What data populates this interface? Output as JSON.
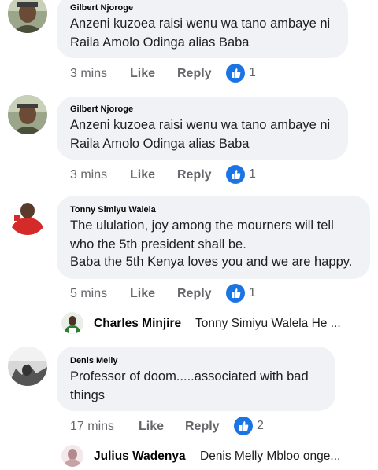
{
  "comments": [
    {
      "author": "Gilbert Njoroge",
      "lines": [
        "Anzeni kuzoea raisi wenu wa tano ambaye ni",
        "Raila Amolo Odinga alias Baba"
      ],
      "time": "3 mins",
      "like_label": "Like",
      "reply_label": "Reply",
      "reaction_count": "1"
    },
    {
      "author": "Gilbert Njoroge",
      "lines": [
        "Anzeni kuzoea raisi wenu wa tano ambaye ni",
        "Raila Amolo Odinga alias Baba"
      ],
      "time": "3 mins",
      "like_label": "Like",
      "reply_label": "Reply",
      "reaction_count": "1"
    },
    {
      "author": "Tonny Simiyu Walela",
      "lines": [
        "The ululation, joy among the mourners will tell",
        "who the 5th president shall be.",
        "Baba the 5th Kenya loves you and we are happy."
      ],
      "time": "5 mins",
      "like_label": "Like",
      "reply_label": "Reply",
      "reaction_count": "1"
    },
    {
      "author": "Denis Melly",
      "lines": [
        "Professor of doom.....associated with bad",
        "things"
      ],
      "time": "17 mins",
      "like_label": "Like",
      "reply_label": "Reply",
      "reaction_count": "2"
    }
  ],
  "replies": [
    {
      "author": "Charles Minjire",
      "preview": "Tonny Simiyu Walela He ..."
    },
    {
      "author": "Julius Wadenya",
      "preview": "Denis Melly Mbloo onge..."
    }
  ],
  "colors": {
    "bubble": "#f0f2f5",
    "meta": "#65676b",
    "like_blue": "#1b74e4"
  },
  "icons": {
    "reaction": "thumbs-up-icon"
  }
}
